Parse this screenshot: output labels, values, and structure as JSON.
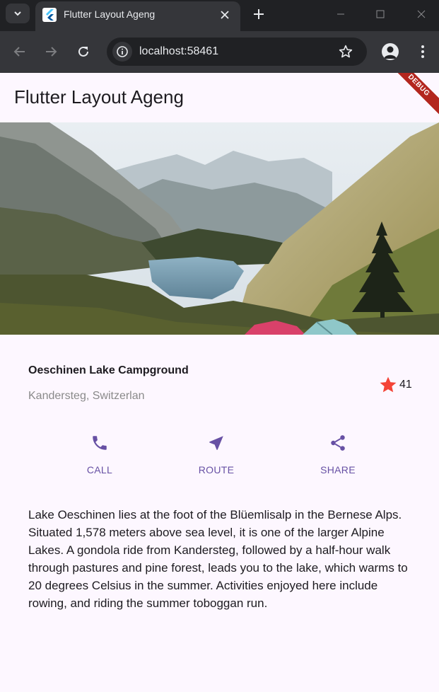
{
  "browser": {
    "tab_title": "Flutter Layout Ageng",
    "url": "localhost:58461"
  },
  "app": {
    "appbar_title": "Flutter Layout Ageng",
    "debug_banner": "DEBUG",
    "place": {
      "name": "Oeschinen Lake Campground",
      "location": "Kandersteg, Switzerlan",
      "rating_count": "41"
    },
    "actions": [
      {
        "label": "CALL",
        "icon": "phone-icon"
      },
      {
        "label": "ROUTE",
        "icon": "near-me-icon"
      },
      {
        "label": "SHARE",
        "icon": "share-icon"
      }
    ],
    "description": "Lake Oeschinen lies at the foot of the Blüemlisalp in the Bernese Alps. Situated 1,578 meters above sea level, it is one of the larger Alpine Lakes. A gondola ride from Kandersteg, followed by a half-hour walk through pastures and pine forest, leads you to the lake, which warms to 20 degrees Celsius in the summer. Activities enjoyed here include rowing, and riding the summer toboggan run."
  },
  "colors": {
    "accent": "#6750a4",
    "star": "#f44336",
    "page_background": "#fdf7ff",
    "browser_frame": "#202124",
    "browser_toolbar": "#35363a"
  }
}
